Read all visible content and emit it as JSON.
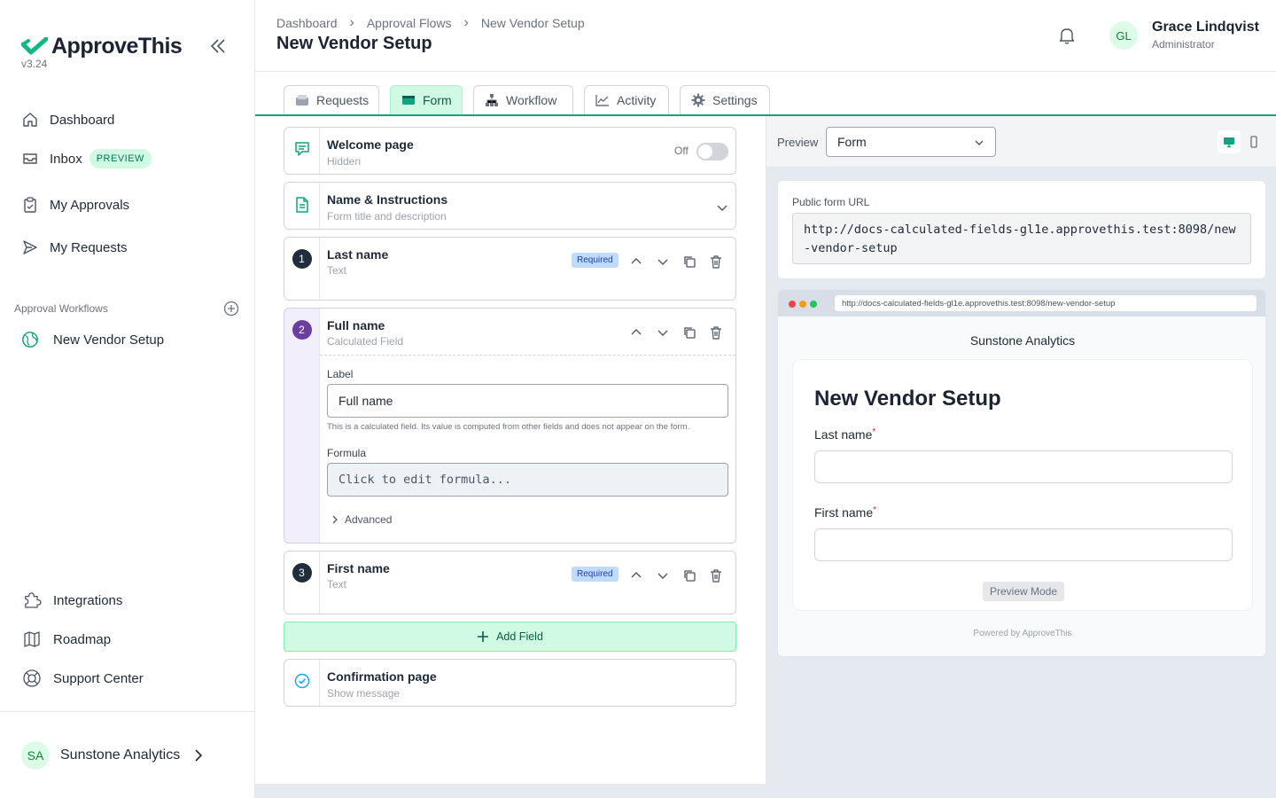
{
  "app": {
    "name": "ApproveThis",
    "version": "v3.24"
  },
  "sidebar": {
    "nav": [
      {
        "label": "Dashboard",
        "icon": "home-icon"
      },
      {
        "label": "Inbox",
        "icon": "inbox-icon",
        "badge": "PREVIEW"
      },
      {
        "label": "My Approvals",
        "icon": "clipboard-icon"
      },
      {
        "label": "My Requests",
        "icon": "send-icon"
      }
    ],
    "section_label": "Approval Workflows",
    "workflows": [
      {
        "label": "New Vendor Setup",
        "icon": "globe-icon"
      }
    ],
    "bottom_nav": [
      {
        "label": "Integrations",
        "icon": "puzzle-icon"
      },
      {
        "label": "Roadmap",
        "icon": "map-icon"
      },
      {
        "label": "Support Center",
        "icon": "lifebuoy-icon"
      }
    ],
    "org": {
      "initials": "SA",
      "name": "Sunstone Analytics"
    }
  },
  "header": {
    "breadcrumb": [
      "Dashboard",
      "Approval Flows",
      "New Vendor Setup"
    ],
    "title": "New Vendor Setup",
    "user": {
      "initials": "GL",
      "name": "Grace Lindqvist",
      "role": "Administrator"
    }
  },
  "tabs": [
    {
      "label": "Requests",
      "icon": "tray-icon"
    },
    {
      "label": "Form",
      "icon": "form-icon",
      "active": true
    },
    {
      "label": "Workflow",
      "icon": "workflow-icon"
    },
    {
      "label": "Activity",
      "icon": "chart-icon"
    },
    {
      "label": "Settings",
      "icon": "gear-icon"
    }
  ],
  "builder": {
    "welcome": {
      "title": "Welcome page",
      "sub": "Hidden",
      "toggle_label": "Off"
    },
    "instructions": {
      "title": "Name & Instructions",
      "sub": "Form title and description"
    },
    "fields": [
      {
        "num": "1",
        "title": "Last name",
        "type": "Text",
        "badge": "Required"
      },
      {
        "num": "2",
        "title": "Full name",
        "type": "Calculated Field",
        "label_caption": "Label",
        "label_value": "Full name",
        "hint": "This is a calculated field. Its value is computed from other fields and does not appear on the form.",
        "formula_caption": "Formula",
        "formula_placeholder": "Click to edit formula...",
        "advanced": "Advanced"
      },
      {
        "num": "3",
        "title": "First name",
        "type": "Text",
        "badge": "Required"
      }
    ],
    "add_field": "Add Field",
    "confirmation": {
      "title": "Confirmation page",
      "sub": "Show message"
    }
  },
  "preview": {
    "label": "Preview",
    "select_value": "Form",
    "url_label": "Public form URL",
    "url": "http://docs-calculated-fields-gl1e.approvethis.test:8098/new-vendor-setup",
    "browser_url": "http://docs-calculated-fields-gl1e.approvethis.test:8098/new-vendor-setup",
    "org_title": "Sunstone Analytics",
    "form_title": "New Vendor Setup",
    "fields": [
      "Last name",
      "First name"
    ],
    "required_marker": "*",
    "mode_button": "Preview Mode",
    "powered_by": "Powered by ApproveThis"
  },
  "colors": {
    "accent": "#10a37f",
    "accent_light": "#d1fae5",
    "dark": "#1c2333",
    "calc_purple": "#6b3fa0"
  }
}
